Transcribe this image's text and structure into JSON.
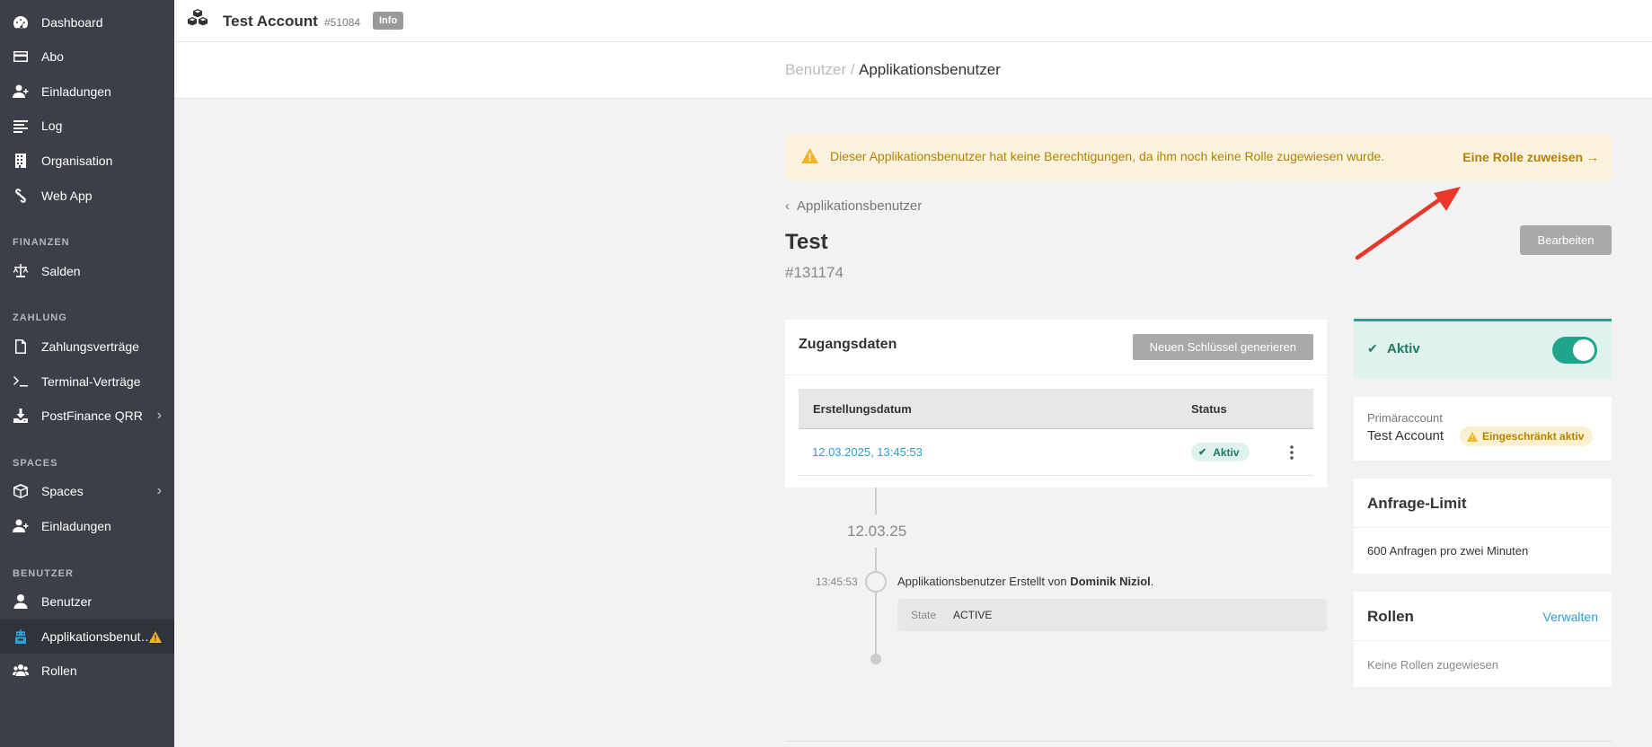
{
  "sidebar": {
    "items": [
      {
        "label": "Dashboard",
        "icon": "dashboard-icon"
      },
      {
        "label": "Abo",
        "icon": "credit-card-icon"
      },
      {
        "label": "Einladungen",
        "icon": "user-plus-icon"
      },
      {
        "label": "Log",
        "icon": "list-icon"
      },
      {
        "label": "Organisation",
        "icon": "building-icon"
      },
      {
        "label": "Web App",
        "icon": "link-icon"
      }
    ],
    "sections": {
      "finanzen": "FINANZEN",
      "zahlung": "ZAHLUNG",
      "spaces": "SPACES",
      "benutzer": "BENUTZER"
    },
    "finanzen_items": [
      {
        "label": "Salden",
        "icon": "balance-scale-icon"
      }
    ],
    "zahlung_items": [
      {
        "label": "Zahlungsverträge",
        "icon": "document-icon"
      },
      {
        "label": "Terminal-Verträge",
        "icon": "terminal-icon"
      },
      {
        "label": "PostFinance QRR",
        "icon": "download-icon"
      }
    ],
    "spaces_items": [
      {
        "label": "Spaces",
        "icon": "cube-icon"
      },
      {
        "label": "Einladungen",
        "icon": "user-plus-icon"
      }
    ],
    "benutzer_items": [
      {
        "label": "Benutzer",
        "icon": "user-icon"
      },
      {
        "label": "Applikationsbenut…",
        "icon": "robot-icon"
      },
      {
        "label": "Rollen",
        "icon": "users-icon"
      }
    ]
  },
  "topbar": {
    "account_name": "Test Account",
    "account_id": "#51084",
    "info_badge": "Info"
  },
  "breadcrumb": {
    "parent": "Benutzer /",
    "current": "Applikationsbenutzer"
  },
  "alert": {
    "message": "Dieser Applikationsbenutzer hat keine Berechtigungen, da ihm noch keine Rolle zugewiesen wurde.",
    "action": "Eine Rolle zuweisen"
  },
  "back_link": "Applikationsbenutzer",
  "page": {
    "title": "Test",
    "id": "#131174",
    "edit_button": "Bearbeiten"
  },
  "credentials": {
    "title": "Zugangsdaten",
    "generate_button": "Neuen Schlüssel generieren",
    "columns": [
      "Erstellungsdatum",
      "Status"
    ],
    "rows": [
      {
        "date": "12.03.2025, 13:45:53",
        "status": "Aktiv"
      }
    ]
  },
  "timeline": {
    "date": "12.03.25",
    "time": "13:45:53",
    "text_prefix": "Applikationsbenutzer Erstellt von ",
    "author": "Dominik Niziol",
    "text_suffix": ".",
    "state_key": "State",
    "state_value": "ACTIVE"
  },
  "status_card": {
    "label": "Aktiv",
    "toggle_on": true
  },
  "primary_account": {
    "label": "Primäraccount",
    "value": "Test Account",
    "badge": "Eingeschränkt aktiv"
  },
  "rate_limit": {
    "title": "Anfrage-Limit",
    "value": "600 Anfragen pro zwei Minuten"
  },
  "roles": {
    "title": "Rollen",
    "manage": "Verwalten",
    "empty": "Keine Rollen zugewiesen"
  },
  "colors": {
    "sidebar_bg": "#3c3f48",
    "accent_teal": "#1fa58b",
    "warning": "#b78100",
    "link": "#2a9fd6",
    "annotation_arrow": "#e8382a"
  }
}
